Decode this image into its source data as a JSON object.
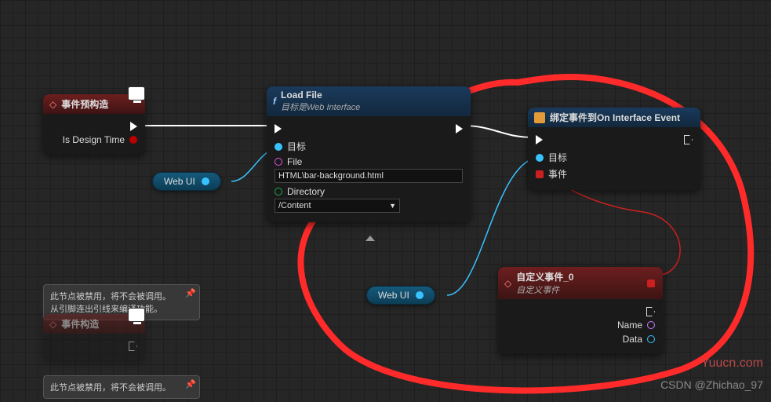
{
  "nodes": {
    "preconstruct": {
      "title": "事件预构造",
      "pin_out_label": "Is Design Time"
    },
    "loadfile": {
      "title": "Load File",
      "subtitle": "目标是Web Interface",
      "pin_target": "目标",
      "pin_file": "File",
      "pin_file_value": "HTML\\bar-background.html",
      "pin_dir": "Directory",
      "pin_dir_value": "/Content"
    },
    "bind": {
      "title": "绑定事件到On Interface Event",
      "pin_target": "目标",
      "pin_event": "事件"
    },
    "custom": {
      "title": "自定义事件_0",
      "subtitle": "自定义事件",
      "pin_name": "Name",
      "pin_data": "Data"
    },
    "construct": {
      "title": "事件构造"
    }
  },
  "pills": {
    "webui1": "Web UI",
    "webui2": "Web UI"
  },
  "notes": {
    "note1_l1": "此节点被禁用，将不会被调用。",
    "note1_l2": "从引脚连出引线来编译功能。",
    "note2_l1": "此节点被禁用，将不会被调用。"
  },
  "watermark": {
    "site": "Yuucn.com",
    "author": "CSDN @Zhichao_97"
  }
}
